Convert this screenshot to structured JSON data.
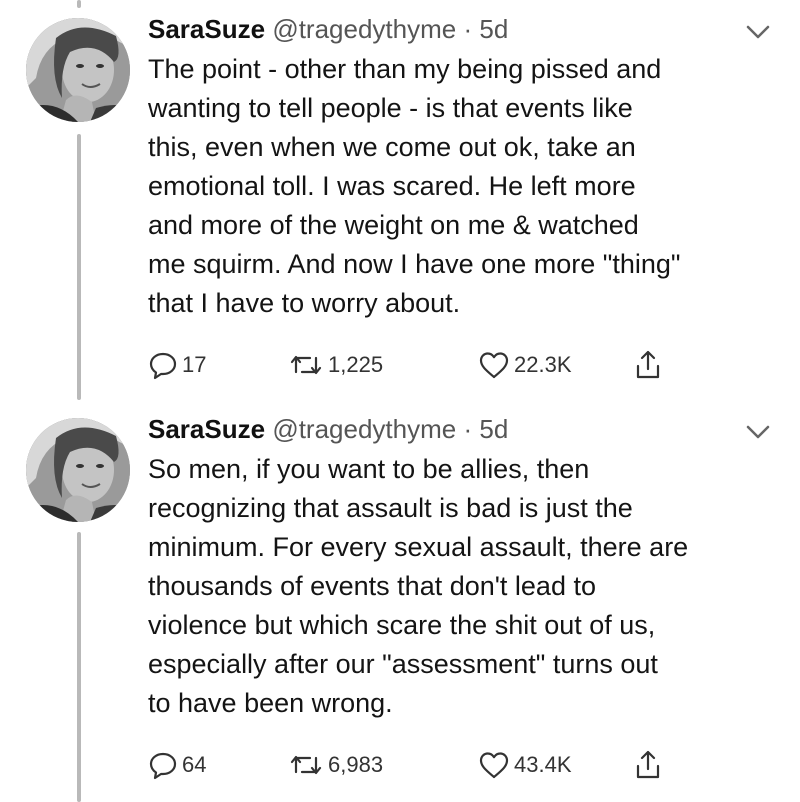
{
  "tweets": [
    {
      "display_name": "SaraSuze",
      "handle": "@tragedythyme",
      "separator": "·",
      "age": "5d",
      "lines": [
        "The point - other than my being pissed and",
        "wanting to tell people - is that events like",
        "this, even when we come out ok, take an",
        "emotional toll. I was scared. He left more",
        "and more of the weight on me & watched",
        "me squirm. And now I have one more \"thing\"",
        "that I have to worry about."
      ],
      "replies": "17",
      "retweets": "1,225",
      "likes": "22.3K"
    },
    {
      "display_name": "SaraSuze",
      "handle": "@tragedythyme",
      "separator": "·",
      "age": "5d",
      "lines": [
        "So men, if you want to be allies, then",
        "recognizing that assault is bad is just the",
        "minimum. For every sexual assault, there are",
        "thousands of events that don't lead to",
        "violence but which scare the shit out of us,",
        "especially after our \"assessment\" turns out",
        "to have been wrong."
      ],
      "replies": "64",
      "retweets": "6,983",
      "likes": "43.4K"
    }
  ],
  "icons": {
    "reply": "reply-icon",
    "retweet": "retweet-icon",
    "like": "heart-icon",
    "share": "share-icon",
    "menu": "chevron-down-icon",
    "avatar": "avatar"
  },
  "colors": {
    "text": "#141414",
    "secondary": "#555555",
    "thread_line": "#b9b9b9",
    "background": "#ffffff"
  }
}
